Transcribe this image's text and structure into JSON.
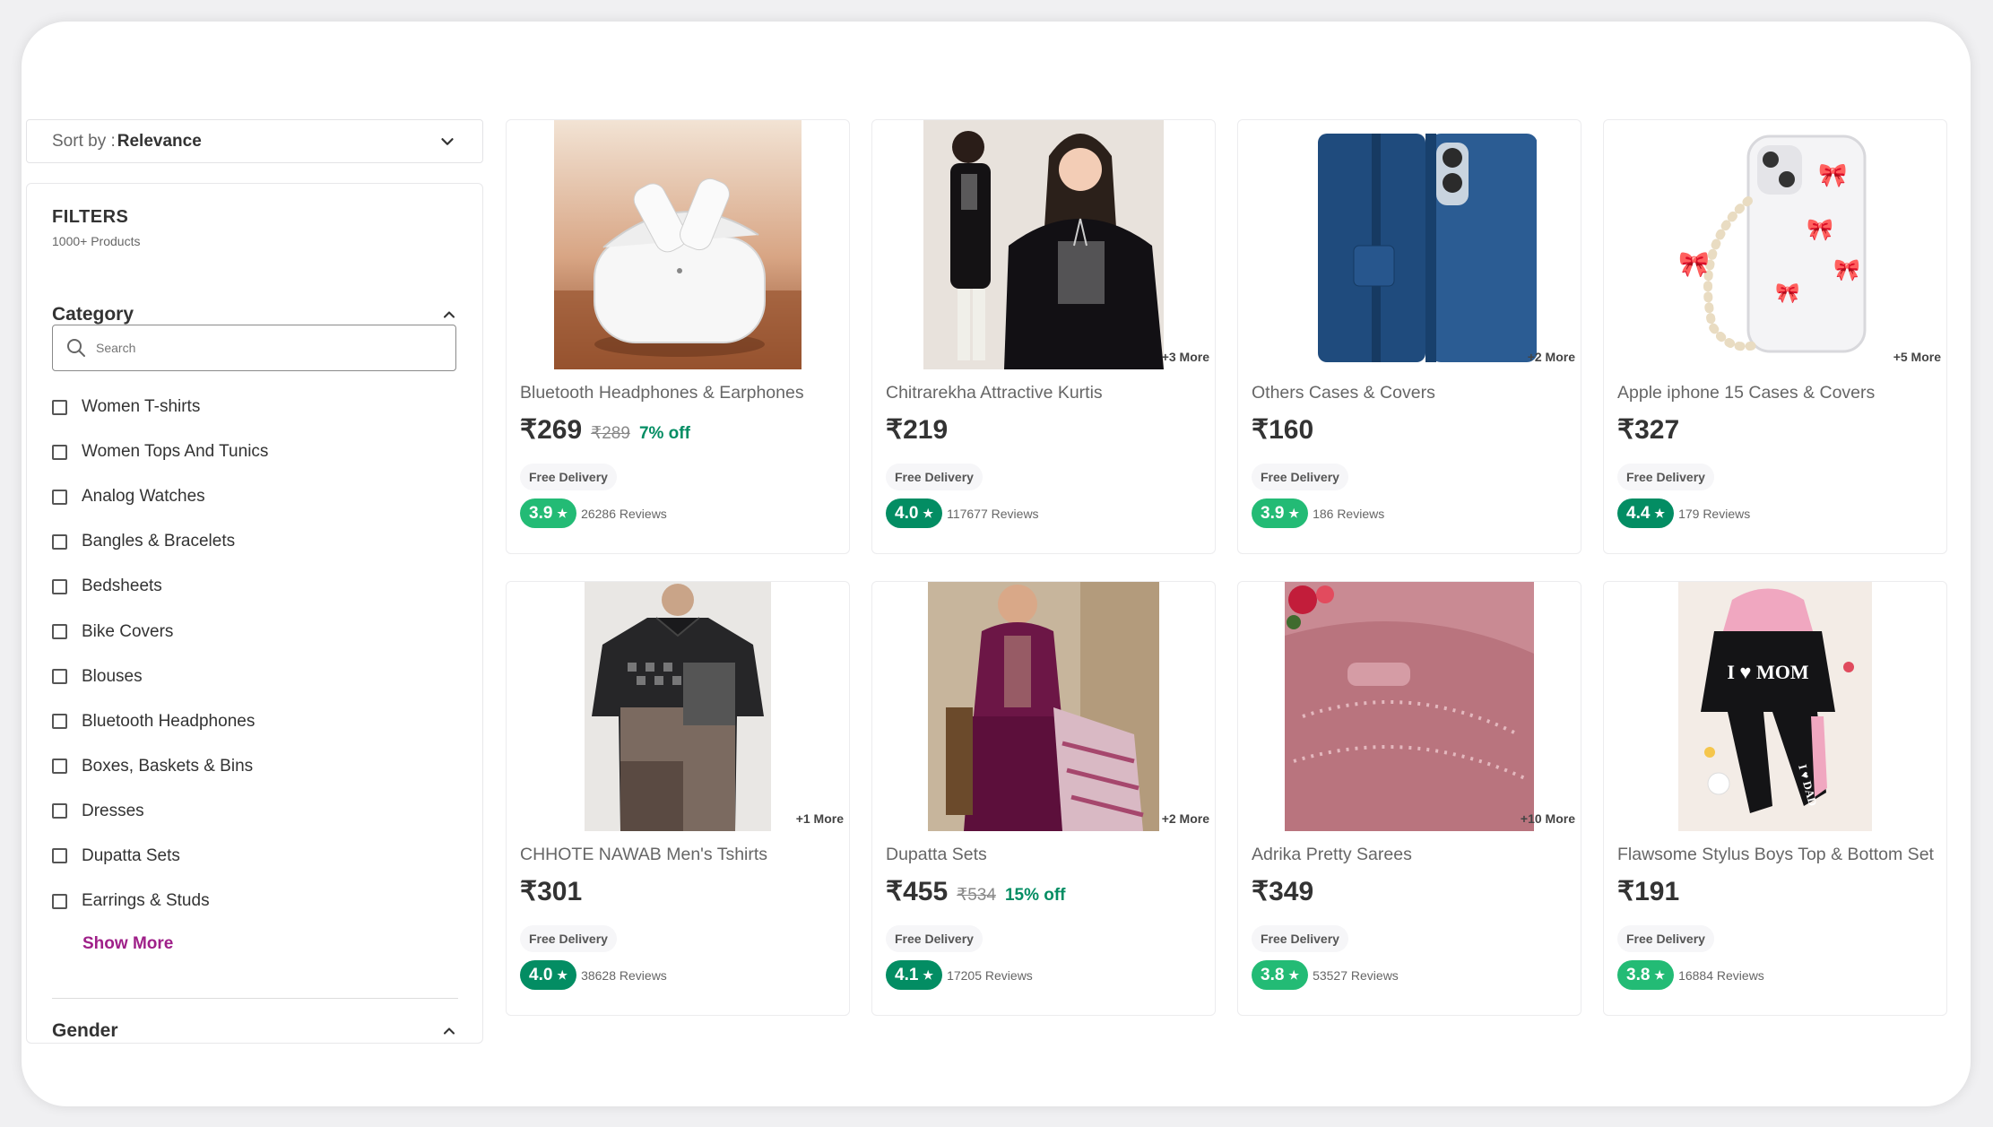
{
  "sort": {
    "prefix": "Sort by : ",
    "value": "Relevance"
  },
  "filters": {
    "title": "FILTERS",
    "count": "1000+ Products",
    "category": {
      "title": "Category",
      "search_placeholder": "Search",
      "items": [
        "Women T-shirts",
        "Women Tops And Tunics",
        "Analog Watches",
        "Bangles & Bracelets",
        "Bedsheets",
        "Bike Covers",
        "Blouses",
        "Bluetooth Headphones",
        "Boxes, Baskets & Bins",
        "Dresses",
        "Dupatta Sets",
        "Earrings & Studs"
      ],
      "show_more": "Show More"
    },
    "gender": {
      "title": "Gender"
    }
  },
  "colors": {
    "accent": "#9f2089",
    "rating_dark": "#038d63",
    "rating_light": "#23bb75"
  },
  "products": [
    {
      "name": "Bluetooth Headphones & Earphones",
      "price": "₹269",
      "mrp": "₹289",
      "off": "7% off",
      "delivery": "Free Delivery",
      "rating": "3.9",
      "reviews": "26286 Reviews",
      "more": "",
      "image_label": "AirPods Pro earbuds in charging case"
    },
    {
      "name": "Chitrarekha Attractive Kurtis",
      "price": "₹219",
      "mrp": "",
      "off": "",
      "delivery": "Free Delivery",
      "rating": "4.0",
      "reviews": "117677 Reviews",
      "more": "+3 More",
      "image_label": "Black embroidered kurti"
    },
    {
      "name": "Others Cases & Covers",
      "price": "₹160",
      "mrp": "",
      "off": "",
      "delivery": "Free Delivery",
      "rating": "3.9",
      "reviews": "186 Reviews",
      "more": "+2 More",
      "image_label": "Blue flip phone cover"
    },
    {
      "name": "Apple iphone 15 Cases & Covers",
      "price": "₹327",
      "mrp": "",
      "off": "",
      "delivery": "Free Delivery",
      "rating": "4.4",
      "reviews": "179 Reviews",
      "more": "+5 More",
      "image_label": "Clear iPhone case with pink bows"
    },
    {
      "name": "CHHOTE NAWAB Men's Tshirts",
      "price": "₹301",
      "mrp": "",
      "off": "",
      "delivery": "Free Delivery",
      "rating": "4.0",
      "reviews": "38628 Reviews",
      "more": "+1 More",
      "image_label": "Men's patterned polo t-shirt"
    },
    {
      "name": "Dupatta Sets",
      "price": "₹455",
      "mrp": "₹534",
      "off": "15% off",
      "delivery": "Free Delivery",
      "rating": "4.1",
      "reviews": "17205 Reviews",
      "more": "+2 More",
      "image_label": "Purple embroidered dupatta set"
    },
    {
      "name": "Adrika Pretty Sarees",
      "price": "₹349",
      "mrp": "",
      "off": "",
      "delivery": "Free Delivery",
      "rating": "3.8",
      "reviews": "53527 Reviews",
      "more": "+10 More",
      "image_label": "Pink sequin saree"
    },
    {
      "name": "Flawsome Stylus Boys Top & Bottom Set",
      "price": "₹191",
      "mrp": "",
      "off": "",
      "delivery": "Free Delivery",
      "rating": "3.8",
      "reviews": "16884 Reviews",
      "more": "",
      "image_label": "Kids hoodie and joggers set"
    }
  ],
  "image_text": {
    "mom_print": "I ♥ MOM",
    "dad_print": "I ♥ DAD"
  }
}
